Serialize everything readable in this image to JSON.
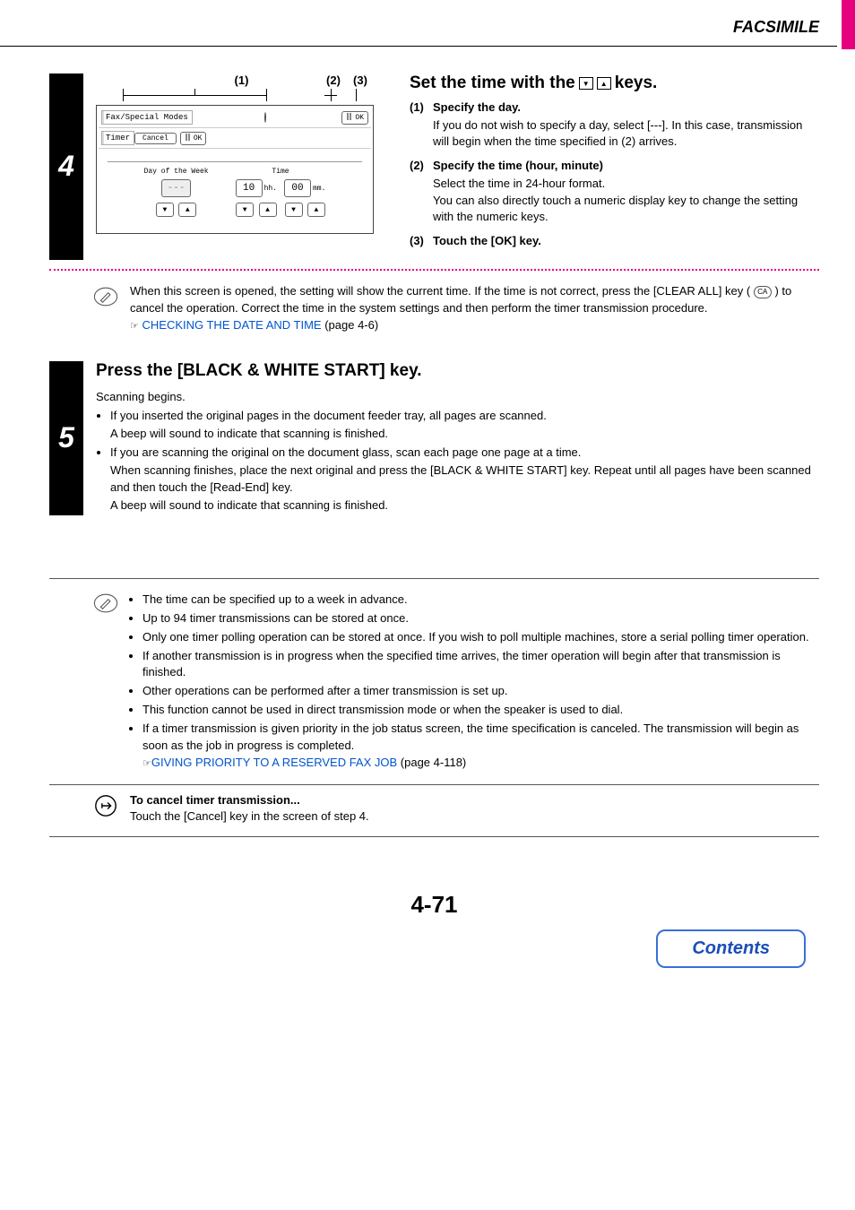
{
  "header": {
    "title": "FACSIMILE"
  },
  "step4": {
    "number": "4",
    "callouts": {
      "c1": "(1)",
      "c2": "(2)",
      "c3": "(3)"
    },
    "lcd": {
      "breadcrumb1": "Fax/Special Modes",
      "breadcrumb2": "Timer",
      "ok": "OK",
      "cancel": "Cancel",
      "day_label": "Day of the Week",
      "time_label": "Time",
      "day_value": "---",
      "hour_value": "10",
      "hour_suffix": "hh.",
      "min_value": "00",
      "min_suffix": "mm."
    },
    "title_pre": "Set the time with the ",
    "title_post": " keys.",
    "items": [
      {
        "num": "(1)",
        "head": "Specify the day.",
        "body": "If you do not wish to specify a day, select [---]. In this case, transmission will begin when the time specified in (2) arrives."
      },
      {
        "num": "(2)",
        "head": "Specify the time (hour, minute)",
        "body": "Select the time in 24-hour format.\nYou can also directly touch a numeric display key to change the setting with the numeric keys."
      },
      {
        "num": "(3)",
        "head": "Touch the [OK] key.",
        "body": ""
      }
    ],
    "note": {
      "line1": "When this screen is opened, the setting will show the current time. If the time is not correct, press the [CLEAR ALL] key ( ",
      "ca": "CA",
      "line2": " ) to cancel the operation. Correct the time in the system settings and then perform the timer transmission procedure.",
      "pointer": "☞",
      "link": "CHECKING THE DATE AND TIME",
      "page": " (page 4-6)"
    }
  },
  "step5": {
    "number": "5",
    "title": "Press the [BLACK & WHITE START] key.",
    "sub": "Scanning begins.",
    "b1a": "If you inserted the original pages in the document feeder tray, all pages are scanned.",
    "b1b": "A beep will sound to indicate that scanning is finished.",
    "b2a": "If you are scanning the original on the document glass, scan each page one page at a time.",
    "b2b": "When scanning finishes, place the next original and press the [BLACK & WHITE START] key. Repeat until all pages have been scanned and then touch the [Read-End] key.",
    "b2c": "A beep will sound to indicate that scanning is finished."
  },
  "big_note": {
    "items": [
      "The time can be specified up to a week in advance.",
      "Up to 94 timer transmissions can be stored at once.",
      "Only one timer polling operation can be stored at once. If you wish to poll multiple machines, store a serial polling timer operation.",
      "If another transmission is in progress when the specified time arrives, the timer operation will begin after that transmission is finished.",
      "Other operations can be performed after a timer transmission is set up.",
      "This function cannot be used in direct transmission mode or when the speaker is used to dial."
    ],
    "last_pre": "If a timer transmission is given priority in the job status screen, the time specification is canceled. The transmission will begin as soon as the job in progress is completed.",
    "pointer": "☞",
    "link": "GIVING PRIORITY TO A RESERVED FAX JOB",
    "page": " (page 4-118)"
  },
  "cancel_note": {
    "head": "To cancel timer transmission...",
    "body": "Touch the [Cancel] key in the screen of step 4."
  },
  "page_number": "4-71",
  "contents": "Contents"
}
